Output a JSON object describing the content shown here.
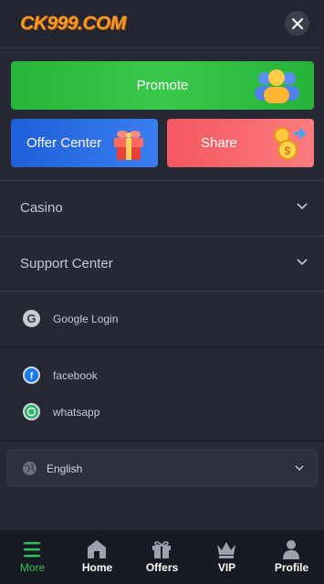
{
  "header": {
    "logo": "CK999.COM"
  },
  "promo": {
    "promote_label": "Promote",
    "offer_center_label": "Offer Center",
    "share_label": "Share"
  },
  "menu": {
    "casino": "Casino",
    "support_center": "Support Center"
  },
  "login": {
    "google": "Google Login"
  },
  "social": {
    "facebook": "facebook",
    "whatsapp": "whatsapp"
  },
  "language": {
    "selected": "English"
  },
  "nav": {
    "items": [
      {
        "label": "More",
        "icon": "menu-icon",
        "active": true
      },
      {
        "label": "Home",
        "icon": "home-icon",
        "active": false
      },
      {
        "label": "Offers",
        "icon": "gift-icon",
        "active": false
      },
      {
        "label": "VIP",
        "icon": "crown-icon",
        "active": false
      },
      {
        "label": "Profile",
        "icon": "user-icon",
        "active": false
      }
    ]
  },
  "colors": {
    "background": "#262834",
    "accent_green": "#2fbf56",
    "promote_green": "#3ac94b",
    "offer_blue": "#2f6fe6",
    "share_red": "#f86a70",
    "logo_orange": "#f59a23"
  }
}
